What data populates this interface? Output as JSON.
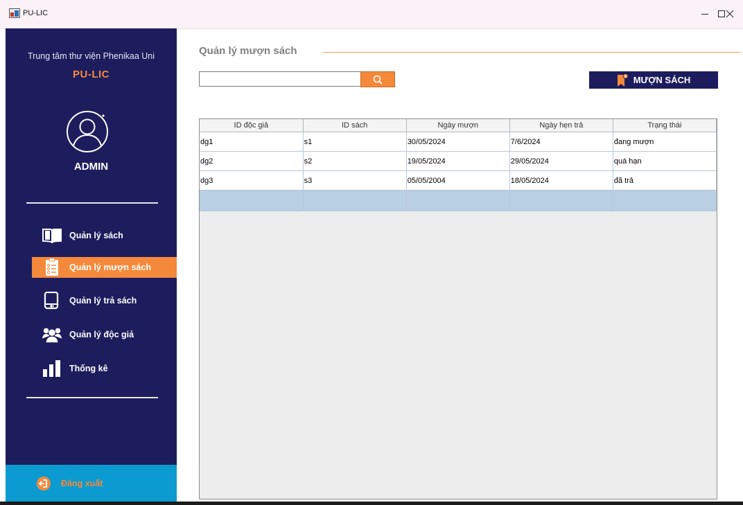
{
  "window": {
    "title": "PU-LIC"
  },
  "sidebar": {
    "org": "Trung tâm thư viện Phenikaa Uni",
    "brand": "PU-LIC",
    "user": "ADMIN",
    "menu": [
      {
        "label": "Quản lý sách",
        "icon": "open-book-icon"
      },
      {
        "label": "Quản lý mượn sách",
        "icon": "checklist-icon",
        "active": true
      },
      {
        "label": "Quản lý trả sách",
        "icon": "book-return-icon"
      },
      {
        "label": "Quản lý độc giả",
        "icon": "users-icon"
      },
      {
        "label": "Thống kê",
        "icon": "bar-chart-icon"
      }
    ],
    "logout": "Đăng xuất"
  },
  "main": {
    "title": "Quản lý mượn sách",
    "search": {
      "value": "",
      "placeholder": ""
    },
    "borrow_button": "MƯỢN SÁCH"
  },
  "table": {
    "columns": [
      "ID độc giả",
      "ID sách",
      "Ngày mượn",
      "Ngày hẹn trả",
      "Trạng thái"
    ],
    "rows": [
      [
        "dg1",
        "s1",
        "30/05/2024",
        "7/6/2024",
        "đang mượn"
      ],
      [
        "dg2",
        "s2",
        "19/05/2024",
        "29/05/2024",
        "quá hạn"
      ],
      [
        "dg3",
        "s3",
        "05/05/2004",
        "18/05/2024",
        "đã trả"
      ],
      [
        "",
        "",
        "",
        "",
        ""
      ]
    ]
  },
  "colors": {
    "sidebar": "#1d1d5e",
    "accent": "#f5893b",
    "logout": "#0b9bd0",
    "selected_row": "#b8cfe4"
  }
}
